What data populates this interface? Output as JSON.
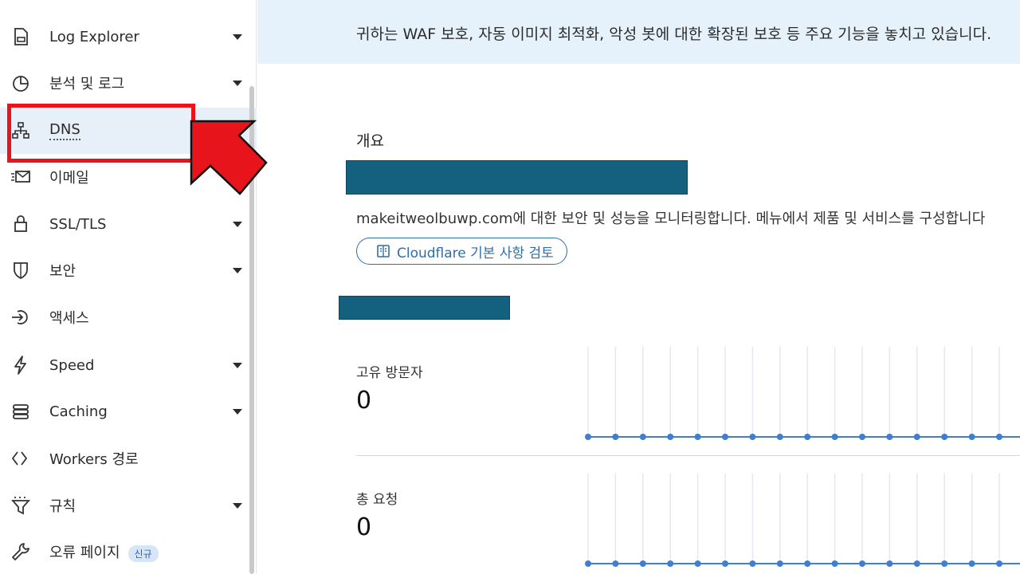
{
  "sidebar": {
    "items": [
      {
        "label": "Log Explorer",
        "icon": "log-explorer-icon",
        "has_caret": true
      },
      {
        "label": "분석 및 로그",
        "icon": "analytics-pie-icon",
        "has_caret": true
      },
      {
        "label": "DNS",
        "icon": "dns-network-icon",
        "has_caret": false,
        "active": true
      },
      {
        "label": "이메일",
        "icon": "email-icon",
        "has_caret": false
      },
      {
        "label": "SSL/TLS",
        "icon": "lock-icon",
        "has_caret": true
      },
      {
        "label": "보안",
        "icon": "shield-icon",
        "has_caret": true
      },
      {
        "label": "액세스",
        "icon": "access-icon",
        "has_caret": false
      },
      {
        "label": "Speed",
        "icon": "lightning-icon",
        "has_caret": true
      },
      {
        "label": "Caching",
        "icon": "caching-stack-icon",
        "has_caret": true
      },
      {
        "label": "Workers 경로",
        "icon": "workers-icon",
        "has_caret": false
      },
      {
        "label": "규칙",
        "icon": "rules-funnel-icon",
        "has_caret": true
      },
      {
        "label": "오류 페이지",
        "icon": "wrench-icon",
        "has_caret": false,
        "badge": "신규"
      }
    ]
  },
  "banner": {
    "text": "귀하는 WAF 보호, 자동 이미지 최적화, 악성 봇에 대한 확장된 보호 등 주요 기능을 놓치고 있습니다."
  },
  "overview": {
    "title": "개요",
    "domain": "makeitweolbuwp.com",
    "description_suffix": "에 대한 보안 및 성능을 모니터링합니다. 메뉴에서 제품 및 서비스를 구성합니다",
    "review_button": "Cloudflare 기본 사항 검토"
  },
  "metrics": [
    {
      "label": "고유 방문자",
      "value": "0"
    },
    {
      "label": "총 요청",
      "value": "0"
    }
  ],
  "colors": {
    "accent": "#2f6ea9",
    "banner_bg": "#e6f2fb",
    "active_bg": "#e7f0f8",
    "highlight_red": "#e8141b",
    "redaction": "#14607f",
    "spark_dot": "#3f7fd1"
  }
}
